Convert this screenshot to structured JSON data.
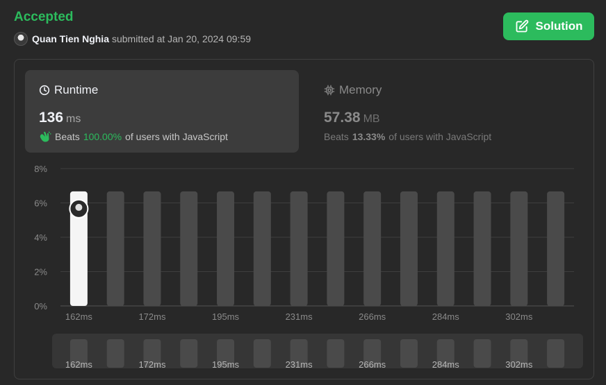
{
  "header": {
    "status": "Accepted",
    "user_name": "Quan Tien Nghia",
    "submitted_text": "submitted at Jan 20, 2024 09:59",
    "solution_label": "Solution"
  },
  "runtime": {
    "title": "Runtime",
    "value": "136",
    "unit": "ms",
    "beats_label": "Beats",
    "beats_pct": "100.00%",
    "beats_suffix": "of users with JavaScript"
  },
  "memory": {
    "title": "Memory",
    "value": "57.38",
    "unit": "MB",
    "beats_label": "Beats",
    "beats_pct": "13.33%",
    "beats_suffix": "of users with JavaScript"
  },
  "icons": {
    "runtime": "clock-icon",
    "memory": "chip-icon",
    "beats": "clapping-hands-icon",
    "solution": "edit-icon"
  },
  "colors": {
    "accent": "#2cbb5d",
    "highlight_bar": "#f5f5f5",
    "bar": "#4a4a4a"
  },
  "chart_data": {
    "type": "bar",
    "ylim": [
      0,
      8
    ],
    "yticks": [
      "8%",
      "6%",
      "4%",
      "2%",
      "0%"
    ],
    "ytick_values": [
      8,
      6,
      4,
      2,
      0
    ],
    "x_tick_labels": [
      "162ms",
      "172ms",
      "195ms",
      "231ms",
      "266ms",
      "284ms",
      "302ms"
    ],
    "values": [
      6.67,
      6.67,
      6.67,
      6.67,
      6.67,
      6.67,
      6.67,
      6.67,
      6.67,
      6.67,
      6.67,
      6.67,
      6.67,
      6.67
    ],
    "highlight_index": 0,
    "grid": true
  }
}
